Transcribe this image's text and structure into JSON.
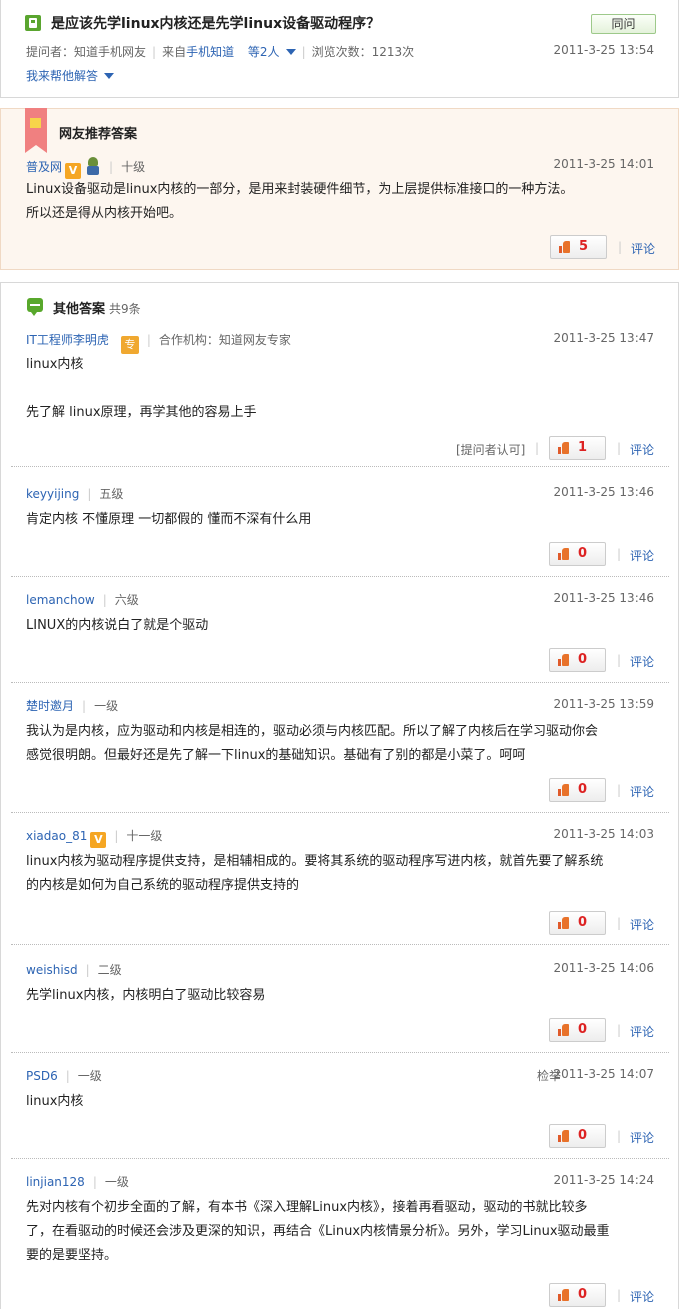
{
  "question": {
    "title": "是应该先学linux内核还是先学linux设备驱动程序？",
    "ask_button": "同问",
    "asker_label": "提问者：知道手机网友",
    "source_prefix": "来自",
    "source_link": "手机知道",
    "people": "等2人",
    "views": "浏览次数：1213次",
    "date": "2011-3-25 13:54",
    "help_link": "我来帮他解答"
  },
  "recommended": {
    "section_title": "网友推荐答案",
    "user": "普及网",
    "level": "十级",
    "date": "2011-3-25 14:01",
    "text_line1": "Linux设备驱动是linux内核的一部分，是用来封装硬件细节，为上层提供标准接口的一种方法。",
    "text_line2": "所以还是得从内核开始吧。",
    "votes": "5",
    "comment": "评论"
  },
  "other": {
    "section_title": "其他答案",
    "count": "共9条",
    "answers": [
      {
        "user": "IT工程师李明虎",
        "badge": "专",
        "org": "合作机构：知道网友专家",
        "date": "2011-3-25 13:47",
        "line1": "linux内核",
        "line2": "",
        "line3": "先了解  linux原理，再学其他的容易上手",
        "approved": "[提问者认可]",
        "votes": "1",
        "comment": "评论"
      },
      {
        "user": "keyyijing",
        "level": "五级",
        "date": "2011-3-25 13:46",
        "line1": "肯定内核  不懂原理  一切都假的  懂而不深有什么用",
        "votes": "0",
        "comment": "评论"
      },
      {
        "user": "lemanchow",
        "level": "六级",
        "date": "2011-3-25 13:46",
        "line1": "LINUX的内核说白了就是个驱动",
        "votes": "0",
        "comment": "评论"
      },
      {
        "user": "楚时邀月",
        "level": "一级",
        "date": "2011-3-25 13:59",
        "line1": "我认为是内核，应为驱动和内核是相连的，驱动必须与内核匹配。所以了解了内核后在学习驱动你会",
        "line2": "感觉很明朗。但最好还是先了解一下linux的基础知识。基础有了别的都是小菜了。呵呵",
        "votes": "0",
        "comment": "评论"
      },
      {
        "user": "xiadao_81",
        "level": "十一级",
        "date": "2011-3-25 14:03",
        "line1": "linux内核为驱动程序提供支持，是相辅相成的。要将其系统的驱动程序写进内核，就首先要了解系统",
        "line2": "的内核是如何为自己系统的驱动程序提供支持的",
        "votes": "0",
        "comment": "评论"
      },
      {
        "user": "weishisd",
        "level": "二级",
        "date": "2011-3-25 14:06",
        "line1": "先学linux内核，内核明白了驱动比较容易",
        "votes": "0",
        "comment": "评论"
      },
      {
        "user": "PSD6",
        "level": "一级",
        "report": "检举",
        "date": "2011-3-25 14:07",
        "line1": "linux内核",
        "votes": "0",
        "comment": "评论"
      },
      {
        "user": "linjian128",
        "level": "一级",
        "date": "2011-3-25 14:24",
        "line1": "先对内核有个初步全面的了解，有本书《深入理解Linux内核》，接着再看驱动，驱动的书就比较多",
        "line2": "了，在看驱动的时候还会涉及更深的知识，再结合《Linux内核情景分析》。另外，学习Linux驱动最重",
        "line3": "要的是要坚持。",
        "votes": "0",
        "comment": "评论"
      }
    ]
  }
}
